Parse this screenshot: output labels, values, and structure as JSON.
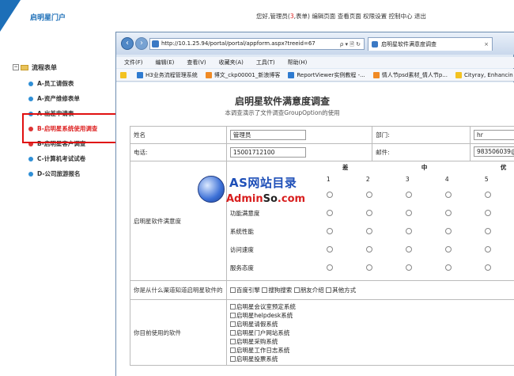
{
  "portal": {
    "title": "启明星门户",
    "user_prefix": "您好,管理员(",
    "user_count": "3",
    "user_sep": ",",
    "user_form": "表单",
    "user_suffix": ")",
    "links": [
      "编辑页面",
      "查看页面",
      "权限设置",
      "控制中心",
      "退出"
    ]
  },
  "tree": {
    "root": "流程表单",
    "items": [
      {
        "label": "A-员工请假表"
      },
      {
        "label": "A-资产维修表单"
      },
      {
        "label": "A-出差申请表"
      },
      {
        "label": "B-启明星系统使用调查"
      },
      {
        "label": "B-启明星客户调查"
      },
      {
        "label": "C-计算机考试试卷"
      },
      {
        "label": "D-公司旅游报名"
      }
    ]
  },
  "browser": {
    "url": "http://10.1.25.94/portal/portal/appform.aspx?treeid=67",
    "addr_tools": "ρ ▾ 🗎 ↻",
    "tab_title": "启明星软件满意度调查",
    "menu": [
      "文件(F)",
      "编辑(E)",
      "查看(V)",
      "收藏夹(A)",
      "工具(T)",
      "帮助(H)"
    ],
    "favorites": [
      {
        "label": "H3业务流程管理系统",
        "icon": "blue"
      },
      {
        "label": "博文_ckp00001_新浪博客",
        "icon": "orange"
      },
      {
        "label": "ReportViewer实例教程 -...",
        "icon": "blue"
      },
      {
        "label": "情人节psd素材_情人节p...",
        "icon": "orange"
      },
      {
        "label": "Cityray, Enhancin",
        "icon": "star"
      }
    ]
  },
  "form": {
    "title": "启明星软件满意度调查",
    "subtitle": "本调查演示了文件调查GroupOption的使用",
    "name_label": "姓名",
    "name_value": "管理员",
    "dept_label": "部门:",
    "dept_value": "hr",
    "phone_label": "电话:",
    "phone_value": "15001712100",
    "email_label": "邮件:",
    "email_value": "983506039@",
    "rating_label": "启明星软件满意度",
    "rating_heads": [
      "差",
      "中",
      "优"
    ],
    "rating_nums": [
      "1",
      "2",
      "3",
      "4",
      "5"
    ],
    "rating_rows": [
      "功能满意度",
      "系统性能",
      "访问速度",
      "服务态度"
    ],
    "source_label": "你是从什么渠道知道启明星软件的",
    "source_options": [
      "百度引擎",
      "搜狗搜索",
      "朋友介绍",
      "其他方式"
    ],
    "software_label": "你目前使用的软件",
    "software_options": [
      "启明星会议室预定系统",
      "启明星helpdesk系统",
      "启明星请假系统",
      "启明星门户网站系统",
      "启明星采购系统",
      "启明星工作日志系统",
      "启明星投票系统"
    ]
  },
  "watermark": {
    "line1": "AS网站目录",
    "line2_a": "Admin",
    "line2_b": "So",
    "line2_c": ".com"
  },
  "colors": {
    "accent": "#1d6fb8",
    "highlight": "#e01010",
    "active_item": "#d22222"
  }
}
